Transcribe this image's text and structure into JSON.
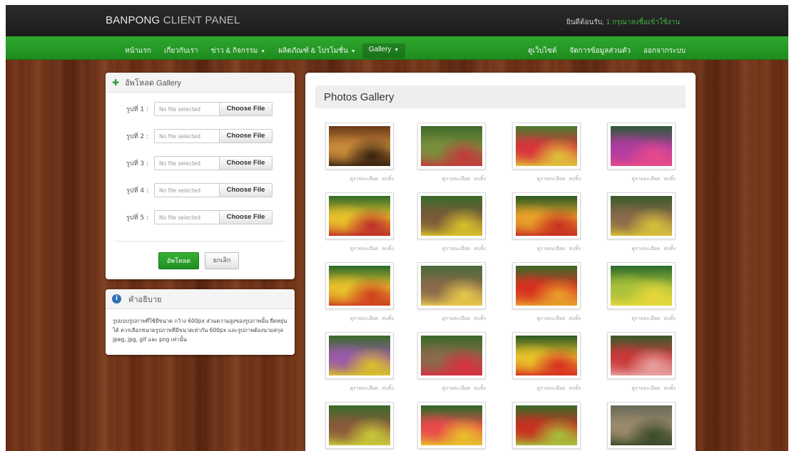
{
  "header": {
    "brand_bold": "BANPONG",
    "brand_light": "CLIENT PANEL",
    "welcome_label": "ยินดีต้อนรับ,",
    "user_name": "1 กรุณาลงชื่อเข้าใช้งาน"
  },
  "nav": {
    "left": [
      {
        "label": "หน้าแรก",
        "has_caret": false
      },
      {
        "label": "เกี่ยวกับเรา",
        "has_caret": false
      },
      {
        "label": "ข่าว & กิจกรรม",
        "has_caret": true
      },
      {
        "label": "ผลิตภัณฑ์ & โปรโมชั่น",
        "has_caret": true
      },
      {
        "label": "Gallery",
        "has_caret": true
      }
    ],
    "right": [
      {
        "label": "ดูเว็บไซต์"
      },
      {
        "label": "จัดการข้อมูลส่วนตัว"
      },
      {
        "label": "ออกจากระบบ"
      }
    ],
    "caret_glyph": "▼"
  },
  "upload": {
    "title": "อัพโหลด Gallery",
    "rows": [
      {
        "label": "รูปที่ 1 :",
        "file": "No file selected",
        "button": "Choose File"
      },
      {
        "label": "รูปที่ 2 :",
        "file": "No file selected",
        "button": "Choose File"
      },
      {
        "label": "รูปที่ 3 :",
        "file": "No file selected",
        "button": "Choose File"
      },
      {
        "label": "รูปที่ 4 :",
        "file": "No file selected",
        "button": "Choose File"
      },
      {
        "label": "รูปที่ 5 :",
        "file": "No file selected",
        "button": "Choose File"
      }
    ],
    "submit_label": "อัพโหลด",
    "cancel_label": "ยกเลิก"
  },
  "info": {
    "title": "คำอธิบาย",
    "text": "รูปแบบรูปภาพที่ใช้มีขนาด กว้าง 600px ส่วนความสูงของรูปภาพนั้น ยืดหยุ่นได้ ควรเลือกขนาดรูปภาพที่มีขนาดเท่ากัน 600px และรูปภาพต้องนามสกุล jpeg, jpg, gif และ png เท่านั้น"
  },
  "gallery": {
    "title": "Photos Gallery",
    "edit_label": "ดูรายละเอียด",
    "delete_label": "ลบทิ้ง",
    "photos": [
      {
        "c": [
          "#6b3a1a",
          "#c98a3a",
          "#3a2410"
        ]
      },
      {
        "c": [
          "#3e6b2a",
          "#7a8f3c",
          "#c23b3b"
        ]
      },
      {
        "c": [
          "#4a7a2e",
          "#d8343a",
          "#e0c23a"
        ]
      },
      {
        "c": [
          "#2d5a3a",
          "#b03ca0",
          "#e84a8a"
        ]
      },
      {
        "c": [
          "#2f6a2a",
          "#e8c02a",
          "#c0302a"
        ]
      },
      {
        "c": [
          "#3a6a2a",
          "#7a5a3a",
          "#d8c02a"
        ]
      },
      {
        "c": [
          "#2a5a22",
          "#e8a02a",
          "#c83020"
        ]
      },
      {
        "c": [
          "#3a5a2a",
          "#8a6a4a",
          "#d8c03a"
        ]
      },
      {
        "c": [
          "#2a6a2a",
          "#e8c02a",
          "#d04020"
        ]
      },
      {
        "c": [
          "#4a6a3a",
          "#8a6a4a",
          "#e8c84a"
        ]
      },
      {
        "c": [
          "#3a6a2a",
          "#d83020",
          "#e8a02a"
        ]
      },
      {
        "c": [
          "#2a6a2a",
          "#a8c03a",
          "#e8d83a"
        ]
      },
      {
        "c": [
          "#3a6a2a",
          "#9a5aa8",
          "#d8c02a"
        ]
      },
      {
        "c": [
          "#3a6a2a",
          "#8a6a4a",
          "#d83040"
        ]
      },
      {
        "c": [
          "#2a5a22",
          "#e8c02a",
          "#d83020"
        ]
      },
      {
        "c": [
          "#3a5a2a",
          "#c83a3a",
          "#e8a0a0"
        ]
      },
      {
        "c": [
          "#3a6a2a",
          "#8a5a3a",
          "#c8c83a"
        ]
      },
      {
        "c": [
          "#2a6a2a",
          "#e84a4a",
          "#e8c02a"
        ]
      },
      {
        "c": [
          "#3a6a2a",
          "#c83020",
          "#a8c03a"
        ]
      },
      {
        "c": [
          "#6a6a5a",
          "#9a8a6a",
          "#3a4a2a"
        ]
      }
    ]
  }
}
